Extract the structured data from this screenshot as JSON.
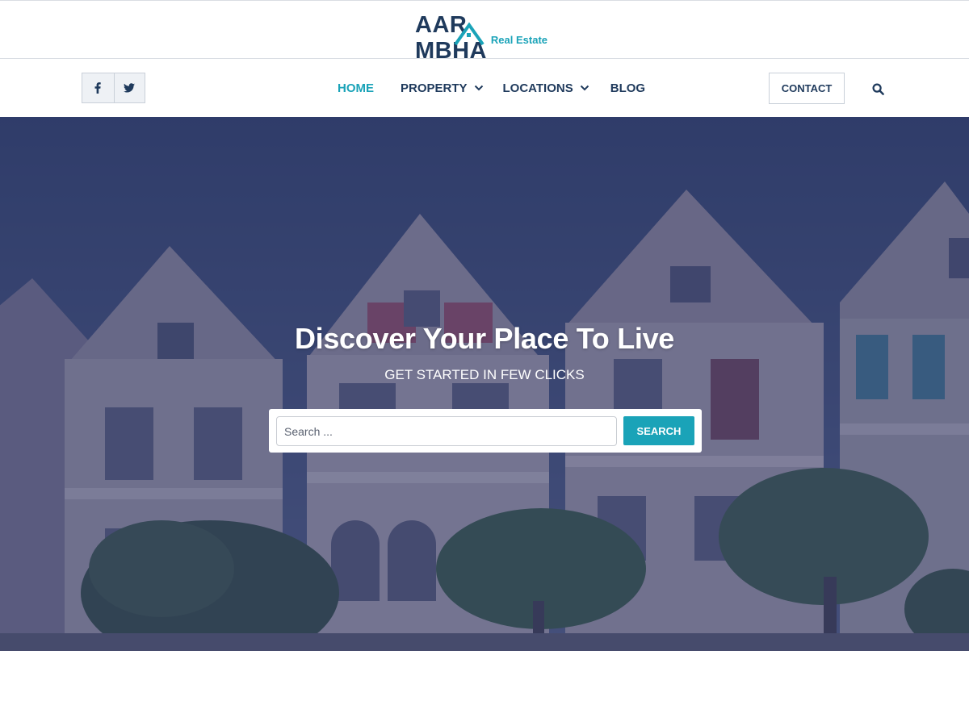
{
  "brand": {
    "name": "AARAMBHA",
    "tagline": "Real Estate",
    "primary_color": "#1f3a5c",
    "accent_color": "#1aa3b8"
  },
  "social": [
    {
      "icon": "facebook-icon"
    },
    {
      "icon": "twitter-icon"
    }
  ],
  "nav": {
    "items": [
      {
        "label": "HOME",
        "active": true
      },
      {
        "label": "PROPERTY",
        "has_dropdown": true
      },
      {
        "label": "LOCATIONS",
        "has_dropdown": true
      },
      {
        "label": "BLOG"
      }
    ],
    "contact_label": "CONTACT",
    "search_icon": "search-icon"
  },
  "hero": {
    "title": "Discover Your Place To Live",
    "subtitle": "GET STARTED IN FEW CLICKS",
    "search": {
      "placeholder": "Search ...",
      "value": "",
      "button_label": "SEARCH"
    }
  }
}
